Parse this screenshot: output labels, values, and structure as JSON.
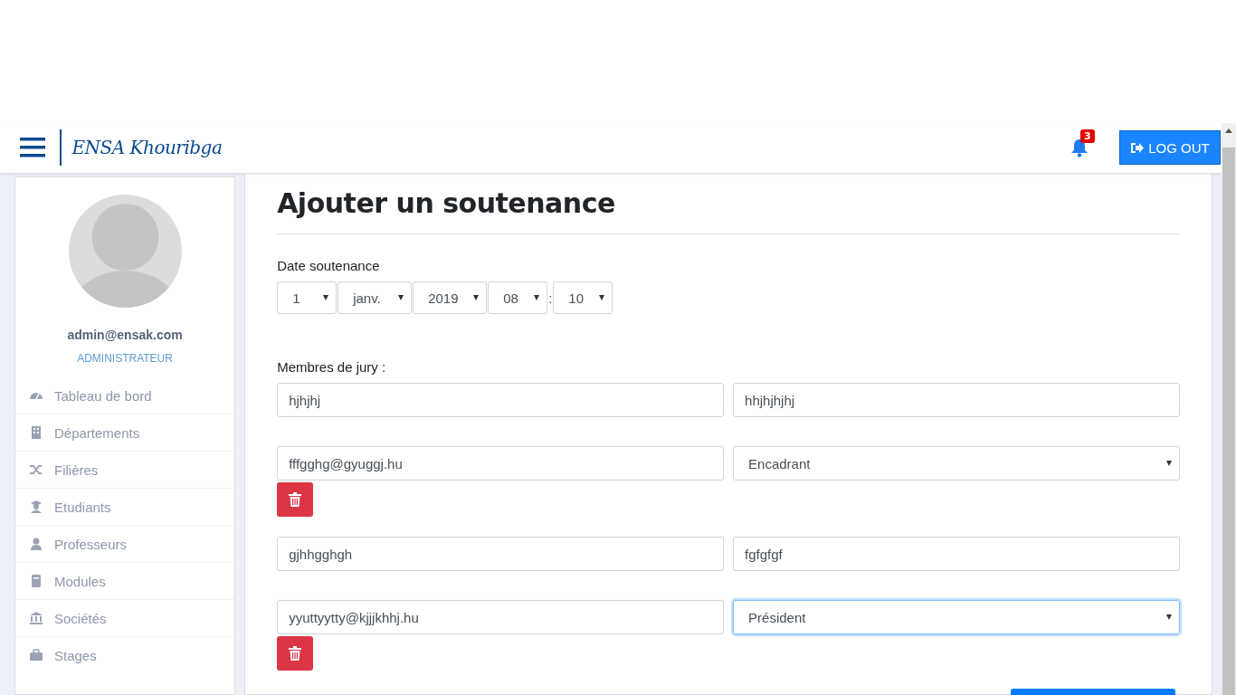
{
  "header": {
    "brand": "ENSA Khouribga",
    "notifications": "3",
    "logout": "LOG OUT"
  },
  "profile": {
    "email": "admin@ensak.com",
    "role": "ADMINISTRATEUR"
  },
  "sidebar": {
    "items": [
      {
        "label": "Tableau de bord"
      },
      {
        "label": "Départements"
      },
      {
        "label": "Filières"
      },
      {
        "label": "Etudiants"
      },
      {
        "label": "Professeurs"
      },
      {
        "label": "Modules"
      },
      {
        "label": "Sociétés"
      },
      {
        "label": "Stages"
      }
    ]
  },
  "form": {
    "title": "Ajouter un soutenance",
    "date_label": "Date soutenance",
    "date_parts": [
      {
        "kind": "select",
        "value": "1"
      },
      {
        "kind": "select",
        "value": "janv."
      },
      {
        "kind": "select",
        "value": "2019"
      },
      {
        "kind": "select",
        "value": "08"
      },
      {
        "kind": "separator",
        "value": ":"
      },
      {
        "kind": "select",
        "value": "10"
      }
    ],
    "jury_label": "Membres de jury :",
    "members": [
      {
        "name": "hjhjhj",
        "surname": "hhjhjhjhj",
        "email": "fffgghg@gyuggj.hu",
        "role": "Encadrant",
        "focused": false
      },
      {
        "name": "gjhhgghgh",
        "surname": "fgfgfgf",
        "email": "yyuttyytty@kjjjkhhj.hu",
        "role": "Président",
        "focused": true
      }
    ]
  }
}
